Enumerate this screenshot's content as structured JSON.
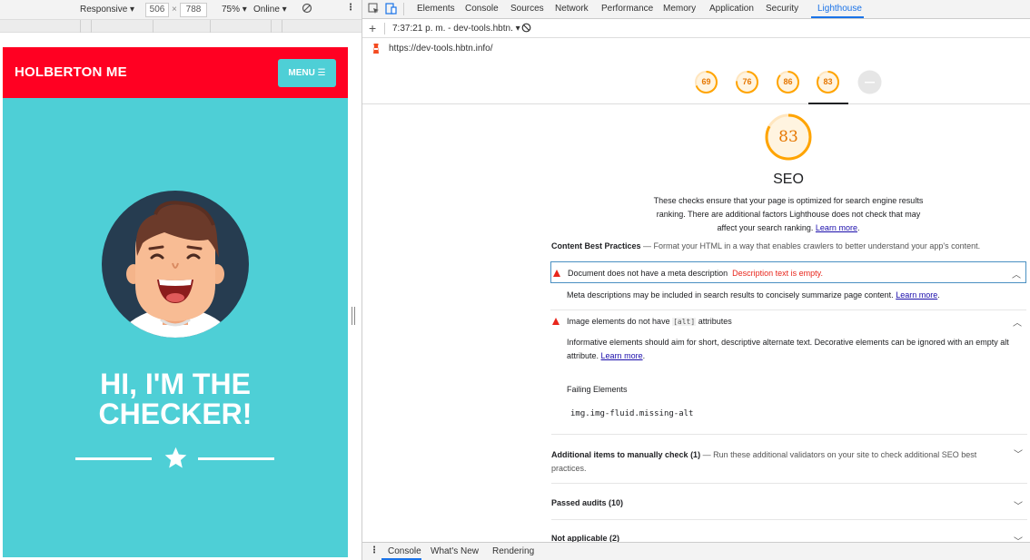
{
  "device_toolbar": {
    "device": "Responsive",
    "width": "506",
    "height": "788",
    "times": "×",
    "zoom": "75%",
    "network": "Online"
  },
  "site": {
    "brand": "HOLBERTON ME",
    "menu_label": "MENU ☰",
    "hero_line1": "HI, I'M THE",
    "hero_line2": "CHECKER!"
  },
  "devtools": {
    "tabs": [
      "Elements",
      "Console",
      "Sources",
      "Network",
      "Performance",
      "Memory",
      "Application",
      "Security",
      "Lighthouse"
    ],
    "active_tab": "Lighthouse",
    "report_selector": "7:37:21 p. m. - dev-tools.hbtn.",
    "url": "https://dev-tools.hbtn.info/"
  },
  "gauges": [
    {
      "score": "69"
    },
    {
      "score": "76"
    },
    {
      "score": "86"
    },
    {
      "score": "83"
    },
    {
      "score": ""
    }
  ],
  "report": {
    "score": "83",
    "score_fraction": 0.83,
    "title": "SEO",
    "desc_line1": "These checks ensure that your page is optimized for search engine results",
    "desc_line2": "ranking. There are additional factors Lighthouse does not check that may",
    "desc_line3": "affect your search ranking.",
    "learn_more": "Learn more",
    "group_title": "Content Best Practices",
    "group_desc": " — Format your HTML in a way that enables crawlers to better understand your app's content.",
    "audit1_title": "Document does not have a meta description",
    "audit1_error": "Description text is empty.",
    "audit1_body": "Meta descriptions may be included in search results to concisely summarize page content.",
    "audit2_title_pre": "Image elements do not have",
    "audit2_code": "[alt]",
    "audit2_title_post": "attributes",
    "audit2_body1": "Informative elements should aim for short, descriptive alternate text. Decorative elements can be ignored with an empty alt",
    "audit2_body2": "attribute.",
    "failing_elements": "Failing Elements",
    "failing_selector": "img.img-fluid.missing-alt",
    "manual_title": "Additional items to manually check",
    "manual_count": "(1)",
    "manual_desc": " — Run these additional validators on your site to check additional SEO best",
    "manual_desc2": "practices.",
    "passed_title": "Passed audits",
    "passed_count": "(10)",
    "na_title": "Not applicable",
    "na_count": "(2)"
  },
  "drawer": {
    "tabs": [
      "Console",
      "What's New",
      "Rendering"
    ]
  },
  "colors": {
    "header_red": "#ff0022",
    "teal": "#4ecfd6",
    "score_orange": "#ffa400",
    "fail_red": "#e8261c",
    "link_blue": "#1a0dab"
  }
}
